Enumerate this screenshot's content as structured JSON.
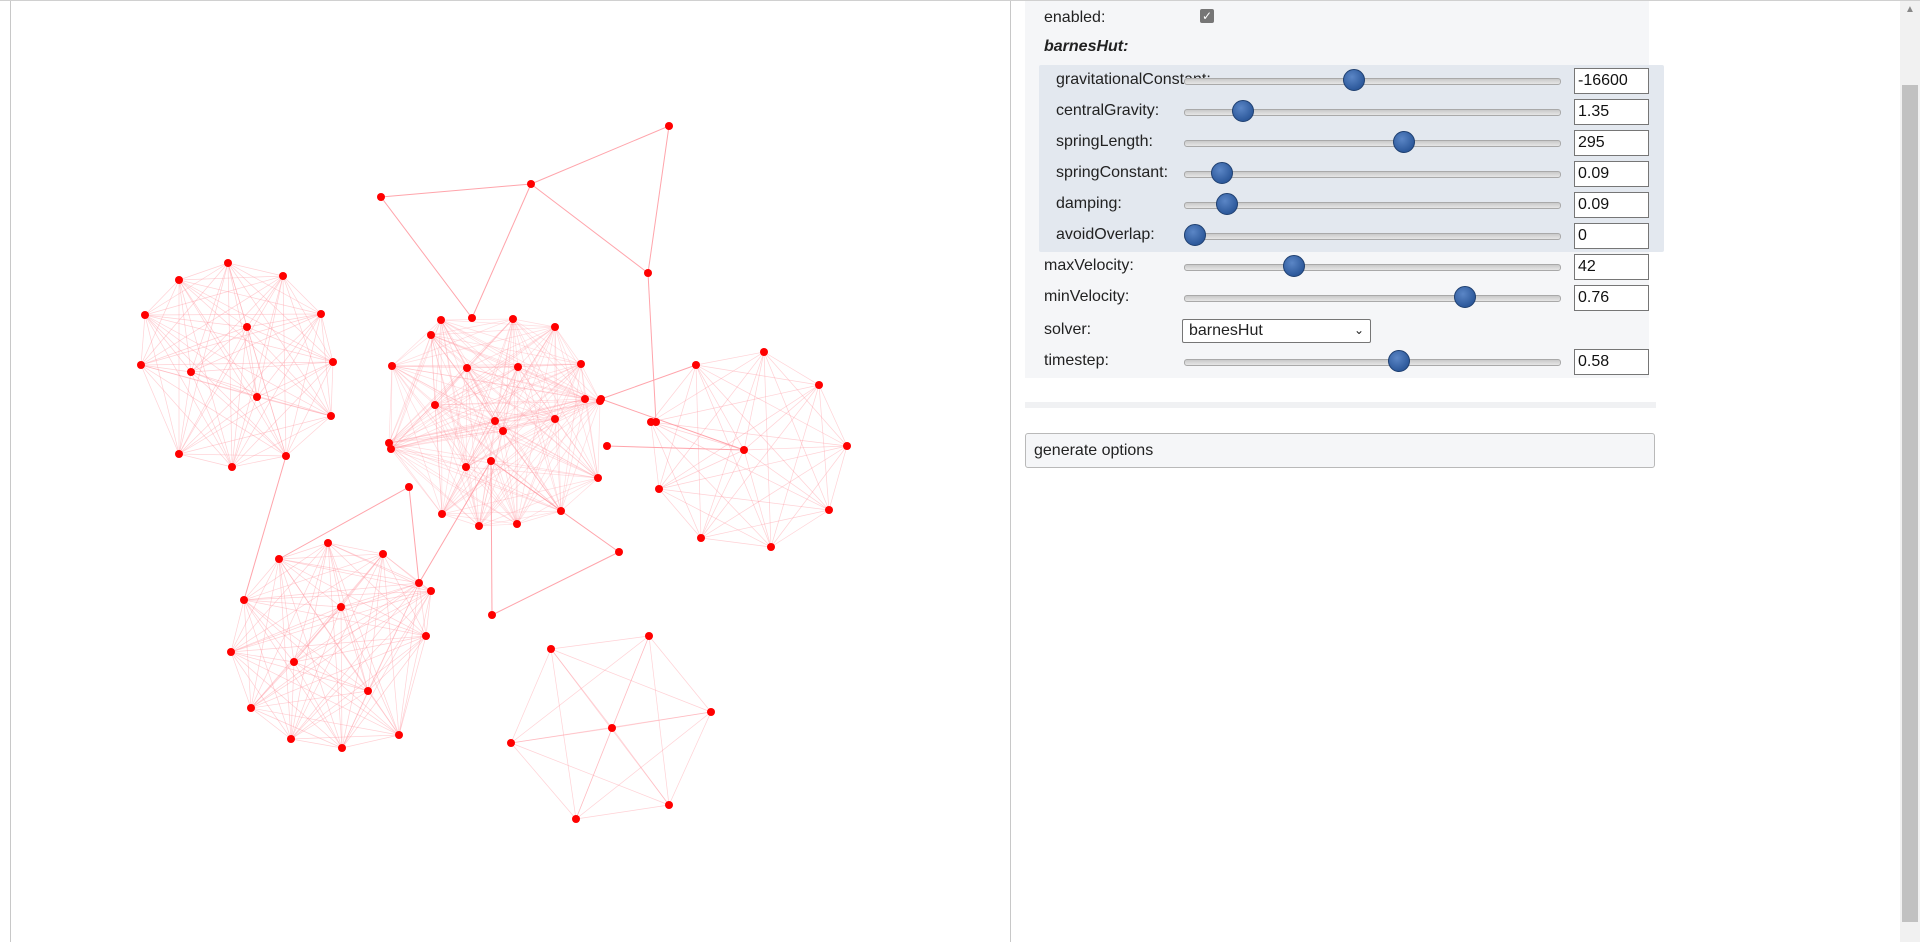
{
  "physics": {
    "enabled_label": "enabled:",
    "enabled": true,
    "barnesHut_header": "barnesHut:",
    "barnesHut": [
      {
        "key": "gravitational",
        "label": "gravitationalConstant:",
        "value": "-16600",
        "min": -30000,
        "max": 0,
        "num": -16600
      },
      {
        "key": "central",
        "label": "centralGravity:",
        "value": "1.35",
        "min": 0,
        "max": 10,
        "num": 1.35
      },
      {
        "key": "springLength",
        "label": "springLength:",
        "value": "295",
        "min": 0,
        "max": 500,
        "num": 295
      },
      {
        "key": "springConstant",
        "label": "springConstant:",
        "value": "0.09",
        "min": 0,
        "max": 1.2,
        "num": 0.09
      },
      {
        "key": "damping",
        "label": "damping:",
        "value": "0.09",
        "min": 0,
        "max": 1,
        "num": 0.09
      },
      {
        "key": "avoidOverlap",
        "label": "avoidOverlap:",
        "value": "0",
        "min": 0,
        "max": 1,
        "num": 0
      }
    ],
    "general": [
      {
        "key": "maxVelocity",
        "label": "maxVelocity:",
        "value": "42",
        "min": 0,
        "max": 150,
        "num": 42
      },
      {
        "key": "minVelocity",
        "label": "minVelocity:",
        "value": "0.76",
        "min": 0,
        "max": 1,
        "num": 0.76
      }
    ],
    "solver_label": "solver:",
    "solver_value": "barnesHut",
    "timestep": {
      "key": "timestep",
      "label": "timestep:",
      "value": "0.58",
      "min": 0.01,
      "max": 1,
      "num": 0.58
    }
  },
  "generate_label": "generate options",
  "colors": {
    "node": "#ff0000",
    "edge": "#ff9aa2",
    "thumb": "#3a66a8",
    "subpanel": "#e3e8ef"
  }
}
